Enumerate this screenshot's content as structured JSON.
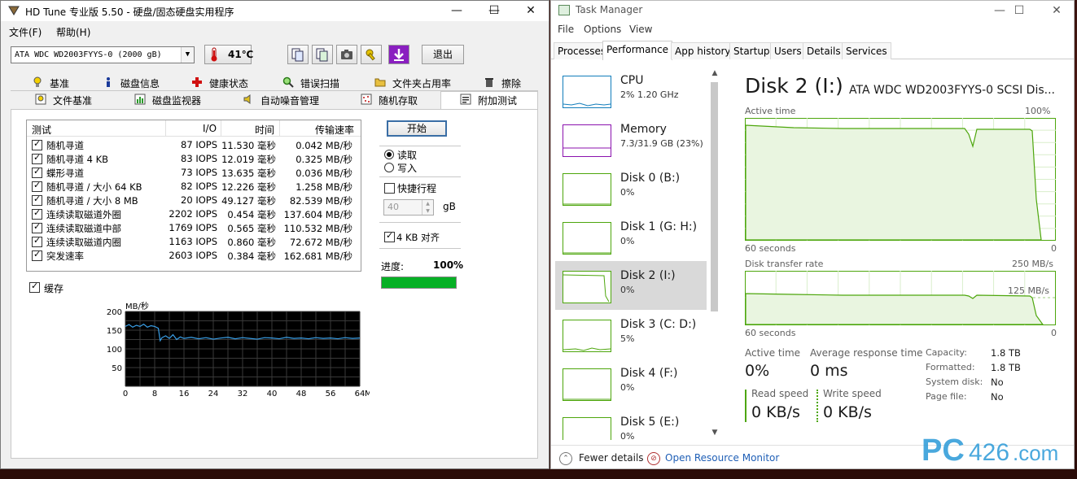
{
  "hdtune": {
    "title": "HD Tune 专业版 5.50 - 硬盘/固态硬盘实用程序",
    "window_buttons": {
      "minimize": "—",
      "maximize": "☐",
      "close": "✕"
    },
    "menu": {
      "file": "文件(F)",
      "help": "帮助(H)"
    },
    "drive_select": "ATA   WDC WD2003FYYS-0 (2000 gB)",
    "temperature": "41℃",
    "exit_label": "退出",
    "tabs_row1": [
      "基准",
      "磁盘信息",
      "健康状态",
      "错误扫描",
      "文件夹占用率",
      "擦除"
    ],
    "tabs_row2": [
      "文件基准",
      "磁盘监视器",
      "自动噪音管理",
      "随机存取",
      "附加测试"
    ],
    "table": {
      "headers": [
        "测试",
        "I/O",
        "时间",
        "传输速率"
      ],
      "rows": [
        {
          "name": "随机寻道",
          "io": "87 IOPS",
          "time": "11.530 毫秒",
          "rate": "0.042 MB/秒"
        },
        {
          "name": "随机寻道 4 KB",
          "io": "83 IOPS",
          "time": "12.019 毫秒",
          "rate": "0.325 MB/秒"
        },
        {
          "name": "蝶形寻道",
          "io": "73 IOPS",
          "time": "13.635 毫秒",
          "rate": "0.036 MB/秒"
        },
        {
          "name": "随机寻道 / 大小 64 KB",
          "io": "82 IOPS",
          "time": "12.226 毫秒",
          "rate": "1.258 MB/秒"
        },
        {
          "name": "随机寻道 / 大小 8 MB",
          "io": "20 IOPS",
          "time": "49.127 毫秒",
          "rate": "82.539 MB/秒"
        },
        {
          "name": "连续读取磁道外圈",
          "io": "2202 IOPS",
          "time": "0.454 毫秒",
          "rate": "137.604 MB/秒"
        },
        {
          "name": "连续读取磁道中部",
          "io": "1769 IOPS",
          "time": "0.565 毫秒",
          "rate": "110.532 MB/秒"
        },
        {
          "name": "连续读取磁道内圈",
          "io": "1163 IOPS",
          "time": "0.860 毫秒",
          "rate": "72.672 MB/秒"
        },
        {
          "name": "突发速率",
          "io": "2603 IOPS",
          "time": "0.384 毫秒",
          "rate": "162.681 MB/秒"
        }
      ]
    },
    "cache_label": "缓存",
    "start_label": "开始",
    "read_label": "读取",
    "write_label": "写入",
    "quick_label": "快捷行程",
    "quick_value": "40",
    "quick_unit": "gB",
    "align_label": "4 KB 对齐",
    "progress_label": "进度:",
    "progress_value": "100%",
    "progress_fraction": 1.0,
    "chart_data": {
      "type": "line",
      "xlabel": "MB",
      "ylabel": "MB/秒",
      "xlim": [
        0,
        64
      ],
      "ylim": [
        0,
        200
      ],
      "x_ticks": [
        0,
        8,
        16,
        24,
        32,
        40,
        48,
        56,
        64
      ],
      "y_ticks": [
        50,
        100,
        150,
        200
      ],
      "grid": true,
      "series": [
        {
          "color": "#3aa0e8",
          "x": [
            0,
            1,
            2,
            3,
            4,
            5,
            6,
            7,
            8,
            9,
            9.5,
            10,
            11,
            12,
            13,
            14,
            15,
            16,
            18,
            20,
            22,
            24,
            26,
            28,
            30,
            32,
            34,
            36,
            38,
            40,
            42,
            44,
            46,
            48,
            50,
            52,
            54,
            56,
            58,
            60,
            62,
            64
          ],
          "y": [
            160,
            165,
            158,
            163,
            160,
            166,
            158,
            162,
            160,
            155,
            122,
            130,
            135,
            128,
            138,
            125,
            132,
            128,
            131,
            127,
            130,
            126,
            129,
            131,
            127,
            130,
            128,
            126,
            130,
            129,
            127,
            131,
            128,
            129,
            127,
            130,
            128,
            129,
            127,
            130,
            128,
            129
          ]
        }
      ]
    }
  },
  "taskmgr": {
    "title": "Task Manager",
    "window_buttons": {
      "minimize": "—",
      "maximize": "☐",
      "close": "✕"
    },
    "menu": [
      "File",
      "Options",
      "View"
    ],
    "tabs": [
      "Processes",
      "Performance",
      "App history",
      "Startup",
      "Users",
      "Details",
      "Services"
    ],
    "active_tab": "Performance",
    "left_items": [
      {
        "name": "CPU",
        "sub": "2% 1.20 GHz",
        "color": "#117dbb"
      },
      {
        "name": "Memory",
        "sub": "7.3/31.9 GB (23%)",
        "color": "#8b12ae"
      },
      {
        "name": "Disk 0 (B:)",
        "sub": "0%",
        "color": "#4da60c"
      },
      {
        "name": "Disk 1 (G: H:)",
        "sub": "0%",
        "color": "#4da60c"
      },
      {
        "name": "Disk 2 (I:)",
        "sub": "0%",
        "color": "#4da60c"
      },
      {
        "name": "Disk 3 (C: D:)",
        "sub": "5%",
        "color": "#4da60c"
      },
      {
        "name": "Disk 4 (F:)",
        "sub": "0%",
        "color": "#4da60c"
      },
      {
        "name": "Disk 5 (E:)",
        "sub": "0%",
        "color": "#4da60c"
      }
    ],
    "selected_item": "Disk 2 (I:)",
    "heading": "Disk 2 (I:)",
    "model": "ATA WDC WD2003FYYS-0 SCSI Dis...",
    "active_time_caption": "Active time",
    "active_time_max": "100%",
    "active_time_span": "60 seconds",
    "active_time_zero": "0",
    "transfer_caption": "Disk transfer rate",
    "transfer_max": "250 MB/s",
    "transfer_mid": "125 MB/s",
    "transfer_span": "60 seconds",
    "transfer_zero": "0",
    "stats": {
      "active_time_label": "Active time",
      "active_time_value": "0%",
      "avg_resp_label": "Average response time",
      "avg_resp_value": "0 ms",
      "read_label": "Read speed",
      "read_value": "0 KB/s",
      "write_label": "Write speed",
      "write_value": "0 KB/s",
      "capacity_label": "Capacity:",
      "capacity_value": "1.8 TB",
      "formatted_label": "Formatted:",
      "formatted_value": "1.8 TB",
      "system_disk_label": "System disk:",
      "system_disk_value": "No",
      "page_file_label": "Page file:",
      "page_file_value": "No"
    },
    "fewer_details": "Fewer details",
    "open_resource_monitor": "Open Resource Monitor"
  },
  "watermark": "PC426.com"
}
